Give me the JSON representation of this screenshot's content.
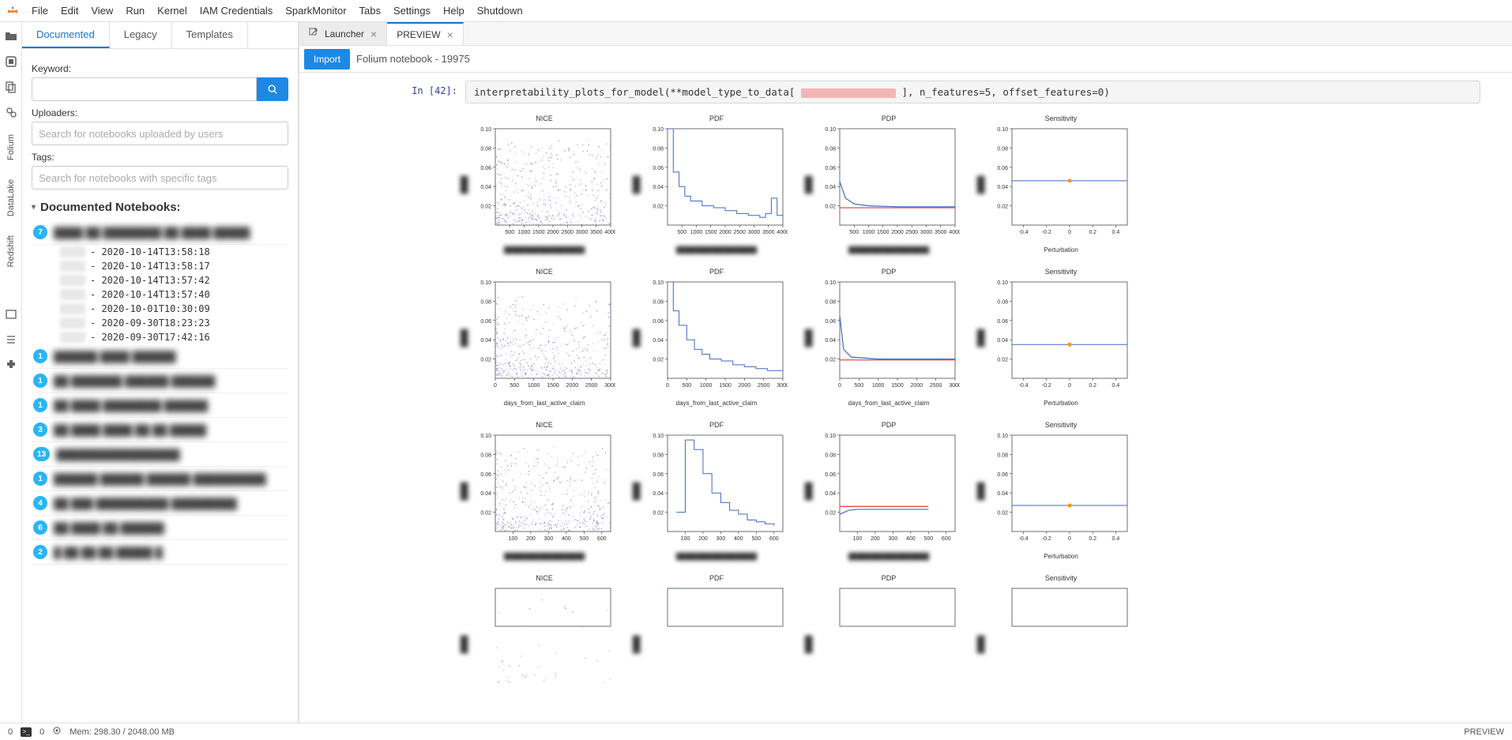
{
  "menubar": [
    "File",
    "Edit",
    "View",
    "Run",
    "Kernel",
    "IAM Credentials",
    "SparkMonitor",
    "Tabs",
    "Settings",
    "Help",
    "Shutdown"
  ],
  "rail": {
    "labels": [
      "Folium",
      "DataLake",
      "Redshift"
    ]
  },
  "left_panel": {
    "tabs": [
      "Documented",
      "Legacy",
      "Templates"
    ],
    "active_tab": 0,
    "labels": {
      "keyword": "Keyword:",
      "uploaders": "Uploaders:",
      "tags": "Tags:"
    },
    "placeholders": {
      "uploaders": "Search for notebooks uploaded by users",
      "tags": "Search for notebooks with specific tags"
    },
    "section_title": "Documented Notebooks:",
    "expanded_versions": [
      "- 2020-10-14T13:58:18",
      "- 2020-10-14T13:58:17",
      "- 2020-10-14T13:57:42",
      "- 2020-10-14T13:57:40",
      "- 2020-10-01T10:30:09",
      "- 2020-09-30T18:23:23",
      "- 2020-09-30T17:42:16"
    ],
    "notebooks": [
      {
        "count": 7,
        "title": "████ ██ ████████ ██ ████ █████"
      },
      {
        "count": 1,
        "title": "██████ ████ ██████"
      },
      {
        "count": 1,
        "title": "██ ███████ ██████ ██████"
      },
      {
        "count": 1,
        "title": "██ ████ ████████ ██████"
      },
      {
        "count": 3,
        "title": "██ ████ ████ ██ ██ █████"
      },
      {
        "count": 13,
        "title": "█████████████████"
      },
      {
        "count": 1,
        "title": "██████ ██████ ██████ ██████████"
      },
      {
        "count": 4,
        "title": "██ ███ ██████████ █████████"
      },
      {
        "count": 6,
        "title": "██ ████ ██ ██████"
      },
      {
        "count": 2,
        "title": "█ ██ ██ ██ █████ █"
      }
    ]
  },
  "doc_tabs": [
    {
      "label": "Launcher",
      "icon": "launch",
      "active": false
    },
    {
      "label": "PREVIEW",
      "icon": "",
      "active": true
    }
  ],
  "import_bar": {
    "button": "Import",
    "title": "Folium notebook - 19975"
  },
  "cell": {
    "prompt": "In [42]:",
    "code_pre": "interpretability_plots_for_model(**model_type_to_data[",
    "code_post": "], n_features=5, offset_features=0)"
  },
  "chart_headers": [
    "NICE",
    "PDF",
    "PDP",
    "Sensitivity"
  ],
  "chart_rows": [
    {
      "xticks": [
        500,
        1000,
        1500,
        2000,
        2500,
        3000,
        3500,
        4000
      ],
      "xmax": 4000,
      "xlabel": "██████████████████"
    },
    {
      "xticks": [
        0,
        500,
        1000,
        1500,
        2000,
        2500,
        3000
      ],
      "xmax": 3000,
      "xlabel": "days_from_last_active_claim"
    },
    {
      "xticks": [
        100,
        200,
        300,
        400,
        500,
        600
      ],
      "xmax": 650,
      "xlabel": "██████████████████"
    },
    {
      "xticks": [],
      "xmax": 100,
      "xlabel": ""
    }
  ],
  "sensitivity": {
    "xticks": [
      -0.4,
      -0.2,
      0.0,
      0.2,
      0.4
    ],
    "xmin": -0.5,
    "xmax": 0.5,
    "xlabel": "Perturbation"
  },
  "yticks": [
    0.02,
    0.04,
    0.06,
    0.08,
    0.1
  ],
  "chart_data": [
    {
      "row": 0,
      "col": 0,
      "type": "scatter",
      "title": "NICE",
      "random_points": true,
      "ylim": [
        0,
        0.1
      ]
    },
    {
      "row": 0,
      "col": 1,
      "type": "line",
      "title": "PDF",
      "x": [
        0,
        200,
        400,
        600,
        800,
        1200,
        1600,
        2000,
        2400,
        2800,
        3200,
        3400,
        3600,
        3800,
        4000
      ],
      "y": [
        0.1,
        0.055,
        0.04,
        0.03,
        0.025,
        0.02,
        0.018,
        0.015,
        0.012,
        0.01,
        0.008,
        0.012,
        0.028,
        0.01,
        0.006
      ],
      "ylim": [
        0,
        0.1
      ],
      "step": true
    },
    {
      "row": 0,
      "col": 2,
      "type": "line",
      "title": "PDP",
      "series": [
        {
          "name": "blue",
          "color": "#4169c9",
          "x": [
            0,
            200,
            500,
            1000,
            2000,
            3000,
            4000
          ],
          "y": [
            0.045,
            0.028,
            0.022,
            0.02,
            0.019,
            0.019,
            0.019
          ]
        },
        {
          "name": "red",
          "color": "#e53935",
          "x": [
            0,
            4000
          ],
          "y": [
            0.018,
            0.018
          ]
        }
      ],
      "ylim": [
        0,
        0.1
      ]
    },
    {
      "row": 0,
      "col": 3,
      "type": "line",
      "title": "Sensitivity",
      "x": [
        -0.5,
        -0.2,
        0,
        0.2,
        0.5
      ],
      "y": [
        0.046,
        0.046,
        0.046,
        0.046,
        0.046
      ],
      "marker_x": 0.0,
      "marker_y": 0.046,
      "ylim": [
        0,
        0.1
      ],
      "xlabel": "Perturbation"
    },
    {
      "row": 1,
      "col": 0,
      "type": "scatter",
      "title": "NICE",
      "random_points": true,
      "ylim": [
        0,
        0.1
      ]
    },
    {
      "row": 1,
      "col": 1,
      "type": "line",
      "title": "PDF",
      "x": [
        0,
        150,
        300,
        500,
        700,
        900,
        1100,
        1400,
        1700,
        2000,
        2300,
        2600,
        3000
      ],
      "y": [
        0.1,
        0.07,
        0.055,
        0.04,
        0.03,
        0.025,
        0.02,
        0.018,
        0.014,
        0.012,
        0.01,
        0.008,
        0.006
      ],
      "ylim": [
        0,
        0.1
      ],
      "step": true,
      "xlabel": "days_from_last_active_claim"
    },
    {
      "row": 1,
      "col": 2,
      "type": "line",
      "title": "PDP",
      "series": [
        {
          "name": "blue",
          "color": "#4169c9",
          "x": [
            0,
            100,
            300,
            1000,
            2000,
            3000
          ],
          "y": [
            0.065,
            0.03,
            0.022,
            0.02,
            0.02,
            0.02
          ]
        },
        {
          "name": "red",
          "color": "#e53935",
          "x": [
            0,
            3000
          ],
          "y": [
            0.019,
            0.019
          ]
        }
      ],
      "ylim": [
        0,
        0.1
      ],
      "xlabel": "days_from_last_active_claim"
    },
    {
      "row": 1,
      "col": 3,
      "type": "line",
      "title": "Sensitivity",
      "x": [
        -0.5,
        -0.2,
        0,
        0.2,
        0.5
      ],
      "y": [
        0.035,
        0.035,
        0.035,
        0.035,
        0.035
      ],
      "marker_x": 0.0,
      "marker_y": 0.035,
      "ylim": [
        0,
        0.1
      ],
      "xlabel": "Perturbation"
    },
    {
      "row": 2,
      "col": 0,
      "type": "scatter",
      "title": "NICE",
      "random_points": true,
      "ylim": [
        0,
        0.1
      ]
    },
    {
      "row": 2,
      "col": 1,
      "type": "line",
      "title": "PDF",
      "x": [
        50,
        100,
        150,
        200,
        250,
        300,
        350,
        400,
        450,
        500,
        550,
        600
      ],
      "y": [
        0.02,
        0.095,
        0.085,
        0.06,
        0.04,
        0.03,
        0.022,
        0.018,
        0.012,
        0.01,
        0.008,
        0.006
      ],
      "ylim": [
        0,
        0.1
      ],
      "step": true
    },
    {
      "row": 2,
      "col": 2,
      "type": "line",
      "title": "PDP",
      "series": [
        {
          "name": "blue",
          "color": "#4169c9",
          "x": [
            0,
            50,
            100,
            200,
            400,
            500
          ],
          "y": [
            0.018,
            0.022,
            0.023,
            0.023,
            0.023,
            0.023
          ]
        },
        {
          "name": "red",
          "color": "#e53935",
          "x": [
            0,
            500
          ],
          "y": [
            0.026,
            0.026
          ]
        }
      ],
      "ylim": [
        0,
        0.1
      ]
    },
    {
      "row": 2,
      "col": 3,
      "type": "line",
      "title": "Sensitivity",
      "x": [
        -0.5,
        -0.2,
        0,
        0.2,
        0.5
      ],
      "y": [
        0.027,
        0.027,
        0.027,
        0.027,
        0.027
      ],
      "marker_x": 0.0,
      "marker_y": 0.027,
      "ylim": [
        0,
        0.1
      ],
      "xlabel": "Perturbation"
    },
    {
      "row": 3,
      "col": 0,
      "type": "scatter",
      "title": "NICE",
      "random_points": true,
      "ylim": [
        0,
        0.1
      ],
      "partial": true
    },
    {
      "row": 3,
      "col": 1,
      "type": "line",
      "title": "PDF",
      "x": [
        0,
        10
      ],
      "y": [
        0.1,
        0.1
      ],
      "ylim": [
        0,
        0.1
      ],
      "partial": true
    },
    {
      "row": 3,
      "col": 2,
      "type": "line",
      "title": "PDP",
      "series": [],
      "ylim": [
        0,
        0.1
      ],
      "partial": true
    },
    {
      "row": 3,
      "col": 3,
      "type": "line",
      "title": "Sensitivity",
      "x": [],
      "y": [],
      "ylim": [
        0,
        0.1
      ],
      "partial": true
    }
  ],
  "statusbar": {
    "left1": "0",
    "left2": "0",
    "mem": "Mem: 298.30 / 2048.00 MB",
    "right": "PREVIEW"
  }
}
